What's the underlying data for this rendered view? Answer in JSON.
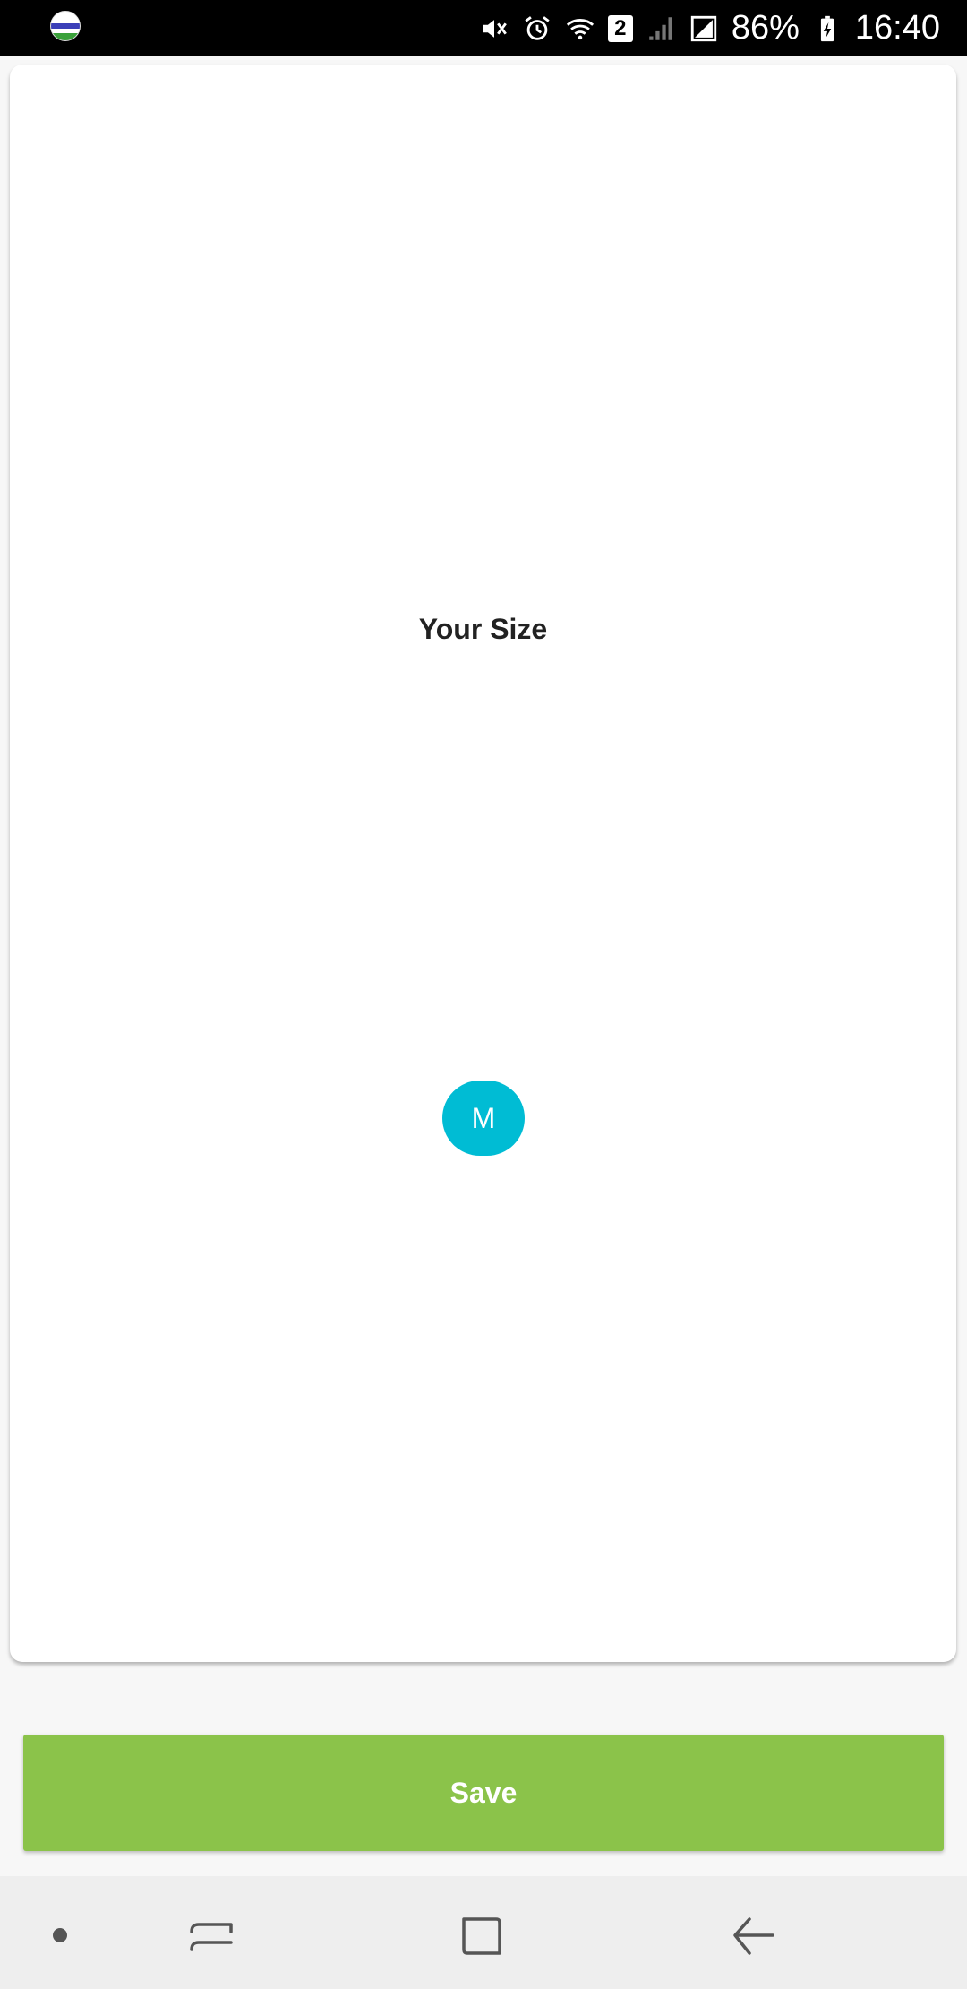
{
  "status_bar": {
    "battery_percent": "86%",
    "time": "16:40",
    "sim_badge": "2",
    "icons": [
      "app-logo-icon",
      "mute-icon",
      "alarm-icon",
      "wifi-icon",
      "sim-2-icon",
      "signal-icon",
      "signal-box-icon",
      "battery-charging-icon"
    ]
  },
  "card": {
    "title": "Your Size",
    "selected_size": "M"
  },
  "save_button": {
    "label": "Save"
  },
  "nav_bar": {
    "icons": [
      "dot-icon",
      "recent-apps-icon",
      "home-icon",
      "back-icon"
    ]
  },
  "colors": {
    "accent_cyan": "#00bcd4",
    "save_green": "#8bc34a"
  }
}
